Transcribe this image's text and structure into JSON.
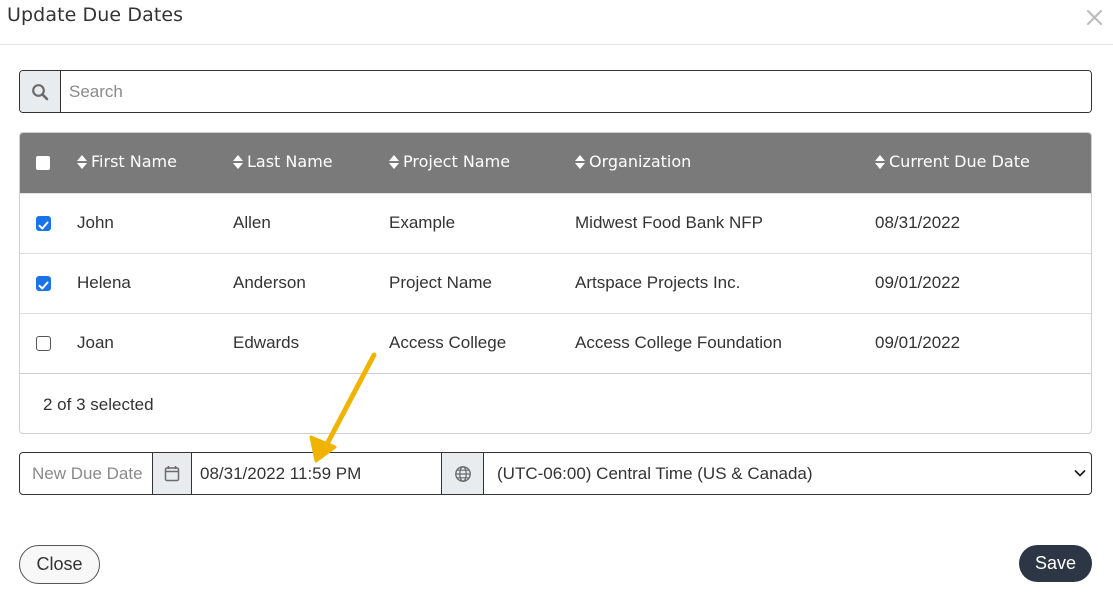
{
  "modal": {
    "title": "Update Due Dates",
    "close_icon": "close-icon"
  },
  "search": {
    "placeholder": "Search",
    "value": "",
    "icon": "search-icon"
  },
  "table": {
    "columns": [
      "First Name",
      "Last Name",
      "Project Name",
      "Organization",
      "Current Due Date"
    ],
    "rows": [
      {
        "checked": true,
        "first": "John",
        "last": "Allen",
        "project": "Example",
        "org": "Midwest Food Bank NFP",
        "due": "08/31/2022"
      },
      {
        "checked": true,
        "first": "Helena",
        "last": "Anderson",
        "project": "Project Name",
        "org": "Artspace Projects Inc.",
        "due": "09/01/2022"
      },
      {
        "checked": false,
        "first": "Joan",
        "last": "Edwards",
        "project": "Access College",
        "org": "Access College Foundation",
        "due": "09/01/2022"
      }
    ],
    "selection_summary": "2 of 3 selected"
  },
  "due_date": {
    "label": "New Due Date",
    "value": "08/31/2022 11:59 PM",
    "calendar_icon": "calendar-icon",
    "globe_icon": "globe-icon",
    "timezone": "(UTC-06:00) Central Time (US & Canada)"
  },
  "buttons": {
    "close": "Close",
    "save": "Save"
  },
  "colors": {
    "header_bg": "#7a7a7a",
    "checkbox_accent": "#1a73e8",
    "save_bg": "#2c3644",
    "annotation_arrow": "#f0b400"
  }
}
